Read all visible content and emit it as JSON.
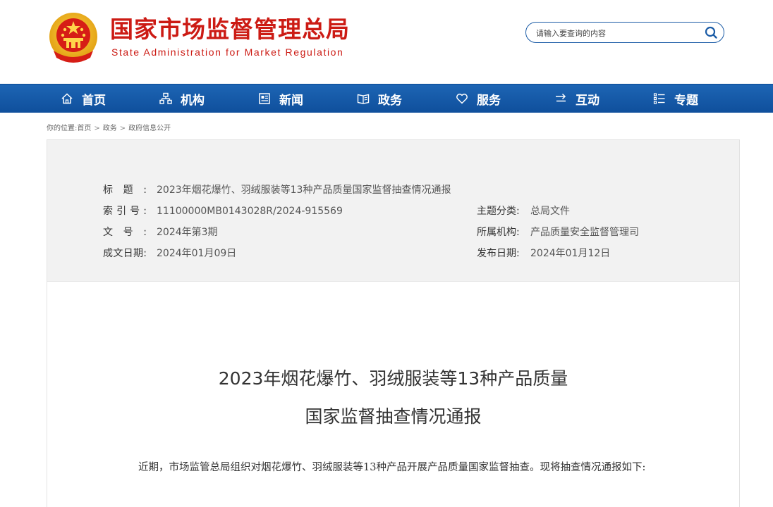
{
  "header": {
    "logo_cn": "国家市场监督管理总局",
    "logo_en": "State Administration for Market Regulation",
    "emblem_icon": "national-emblem-icon",
    "brand_red": "#cc1b14",
    "search": {
      "placeholder": "请输入要查询的内容",
      "icon": "search-icon"
    }
  },
  "nav": {
    "color": "#1861b0",
    "items": [
      {
        "label": "首页",
        "icon": "home-icon"
      },
      {
        "label": "机构",
        "icon": "org-chart-icon"
      },
      {
        "label": "新闻",
        "icon": "news-icon"
      },
      {
        "label": "政务",
        "icon": "book-icon"
      },
      {
        "label": "服务",
        "icon": "heart-icon"
      },
      {
        "label": "互动",
        "icon": "exchange-arrows-icon"
      },
      {
        "label": "专题",
        "icon": "list-icon"
      }
    ]
  },
  "breadcrumb": {
    "prefix": "你的位置:",
    "items": [
      "首页",
      "政务",
      "政府信息公开"
    ],
    "separator": ">"
  },
  "meta": {
    "title_label": "标题:",
    "title_value": "2023年烟花爆竹、羽绒服装等13种产品质量国家监督抽查情况通报",
    "index_label": "索引号:",
    "index_value": "11100000MB0143028R/2024-915569",
    "docno_label": "文号:",
    "docno_value": "2024年第3期",
    "created_label": "成文日期:",
    "created_value": "2024年01月09日",
    "category_label": "主题分类:",
    "category_value": "总局文件",
    "org_label": "所属机构:",
    "org_value": "产品质量安全监督管理司",
    "published_label": "发布日期:",
    "published_value": "2024年01月12日"
  },
  "article": {
    "title_line1": "2023年烟花爆竹、羽绒服装等13种产品质量",
    "title_line2": "国家监督抽查情况通报",
    "paragraph1": "近期，市场监管总局组织对烟花爆竹、羽绒服装等13种产品开展产品质量国家监督抽查。现将抽查情况通报如下:"
  }
}
